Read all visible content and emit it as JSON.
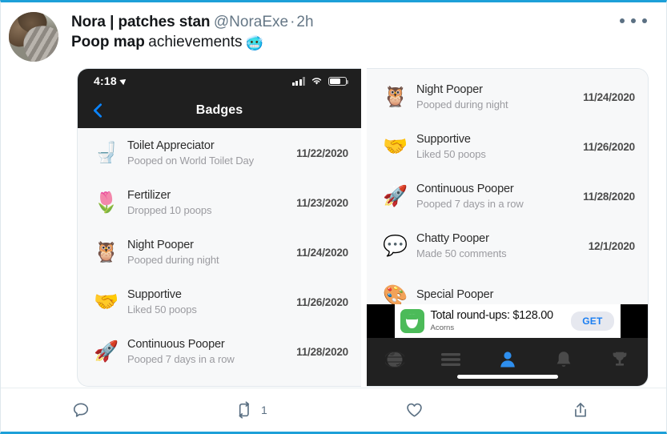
{
  "tweet": {
    "author_name": "Nora | patches stan",
    "handle": "@NoraExe",
    "separator": "·",
    "age": "2h",
    "body_bold": "Poop map",
    "body_plain": "achievements",
    "body_emoji": "🥶",
    "avatar_name": "cat-avatar",
    "more_icon": "more-horizontal-icon"
  },
  "actions": [
    {
      "name": "reply",
      "icon": "reply-icon",
      "count": ""
    },
    {
      "name": "retweet",
      "icon": "retweet-icon",
      "count": "1"
    },
    {
      "name": "like",
      "icon": "heart-icon",
      "count": ""
    },
    {
      "name": "share",
      "icon": "share-icon",
      "count": ""
    }
  ],
  "phone_left": {
    "status_bar": {
      "time": "4:18",
      "location_icon": "location-arrow-icon",
      "signal_icon": "cellular-signal-icon",
      "wifi_icon": "wifi-icon",
      "battery_icon": "battery-icon"
    },
    "nav": {
      "back_icon": "chevron-left-icon",
      "title": "Badges"
    },
    "badges": [
      {
        "emoji": "🚽",
        "emoji_name": "toilet-emoji",
        "title": "Toilet Appreciator",
        "subtitle": "Pooped on World Toilet Day",
        "date": "11/22/2020"
      },
      {
        "emoji": "🌷",
        "emoji_name": "tulip-emoji",
        "title": "Fertilizer",
        "subtitle": "Dropped 10 poops",
        "date": "11/23/2020"
      },
      {
        "emoji": "🦉",
        "emoji_name": "owl-emoji",
        "title": "Night Pooper",
        "subtitle": "Pooped during night",
        "date": "11/24/2020"
      },
      {
        "emoji": "🤝",
        "emoji_name": "handshake-emoji",
        "title": "Supportive",
        "subtitle": "Liked 50 poops",
        "date": "11/26/2020"
      },
      {
        "emoji": "🚀",
        "emoji_name": "rocket-emoji",
        "title": "Continuous Pooper",
        "subtitle": "Pooped 7 days in a row",
        "date": "11/28/2020"
      }
    ]
  },
  "phone_right": {
    "badges": [
      {
        "emoji": "🦉",
        "emoji_name": "owl-emoji",
        "title": "Night Pooper",
        "subtitle": "Pooped during night",
        "date": "11/24/2020"
      },
      {
        "emoji": "🤝",
        "emoji_name": "handshake-emoji",
        "title": "Supportive",
        "subtitle": "Liked 50 poops",
        "date": "11/26/2020"
      },
      {
        "emoji": "🚀",
        "emoji_name": "rocket-emoji",
        "title": "Continuous Pooper",
        "subtitle": "Pooped 7 days in a row",
        "date": "11/28/2020"
      },
      {
        "emoji": "💬",
        "emoji_name": "speech-balloon-emoji",
        "title": "Chatty Pooper",
        "subtitle": "Made 50 comments",
        "date": "12/1/2020"
      },
      {
        "emoji": "🎨",
        "emoji_name": "palette-emoji",
        "title": "Special Pooper",
        "subtitle": "",
        "date": ""
      }
    ],
    "ad": {
      "icon_name": "acorns-app-icon",
      "title": "Total round-ups: $128.00",
      "brand": "Acorns",
      "cta": "GET"
    },
    "tabs": [
      {
        "name": "tab-globe",
        "icon": "globe-icon",
        "active": false
      },
      {
        "name": "tab-feed",
        "icon": "list-lines-icon",
        "active": false
      },
      {
        "name": "tab-profile",
        "icon": "person-icon",
        "active": true
      },
      {
        "name": "tab-notifications",
        "icon": "bell-icon",
        "active": false
      },
      {
        "name": "tab-achievements",
        "icon": "trophy-icon",
        "active": false
      }
    ],
    "home_indicator": "home-indicator"
  },
  "colors": {
    "twitter_blue": "#1da0d8",
    "ios_blue": "#1a7ef2",
    "acorns_green": "#4cbb59",
    "dark_chrome": "#1f1f1f"
  }
}
